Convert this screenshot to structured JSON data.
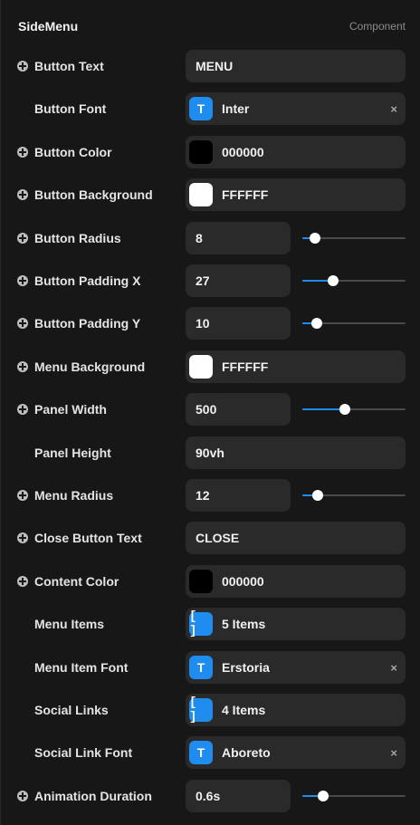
{
  "header": {
    "title": "SideMenu",
    "subtitle": "Component"
  },
  "rows": [
    {
      "label": "Button Text",
      "plus": true,
      "kind": "text",
      "value": "MENU"
    },
    {
      "label": "Button Font",
      "plus": false,
      "kind": "font",
      "value": "Inter",
      "chip": "T"
    },
    {
      "label": "Button Color",
      "plus": true,
      "kind": "color",
      "value": "000000",
      "swatch": "#000000"
    },
    {
      "label": "Button Background",
      "plus": true,
      "kind": "color",
      "value": "FFFFFF",
      "swatch": "#ffffff"
    },
    {
      "label": "Button Radius",
      "plus": true,
      "kind": "slider",
      "value": "8",
      "level": 0.12
    },
    {
      "label": "Button Padding X",
      "plus": true,
      "kind": "slider",
      "value": "27",
      "level": 0.3
    },
    {
      "label": "Button Padding Y",
      "plus": true,
      "kind": "slider",
      "value": "10",
      "level": 0.14
    },
    {
      "label": "Menu Background",
      "plus": true,
      "kind": "color",
      "value": "FFFFFF",
      "swatch": "#ffffff"
    },
    {
      "label": "Panel Width",
      "plus": true,
      "kind": "slider",
      "value": "500",
      "level": 0.41
    },
    {
      "label": "Panel Height",
      "plus": false,
      "kind": "text",
      "value": "90vh"
    },
    {
      "label": "Menu Radius",
      "plus": true,
      "kind": "slider",
      "value": "12",
      "level": 0.15
    },
    {
      "label": "Close Button Text",
      "plus": true,
      "kind": "text",
      "value": "CLOSE"
    },
    {
      "label": "Content Color",
      "plus": true,
      "kind": "color",
      "value": "000000",
      "swatch": "#000000"
    },
    {
      "label": "Menu Items",
      "plus": false,
      "kind": "array",
      "value": "5 Items",
      "chip": "[ ]"
    },
    {
      "label": "Menu Item Font",
      "plus": false,
      "kind": "font",
      "value": "Erstoria",
      "chip": "T"
    },
    {
      "label": "Social Links",
      "plus": false,
      "kind": "array",
      "value": "4 Items",
      "chip": "[ ]"
    },
    {
      "label": "Social Link Font",
      "plus": false,
      "kind": "font",
      "value": "Aboreto",
      "chip": "T"
    },
    {
      "label": "Animation Duration",
      "plus": true,
      "kind": "slider",
      "value": "0.6s",
      "level": 0.2
    }
  ],
  "clear_glyph": "×",
  "colors": {
    "accent": "#1f8cf0",
    "field": "#2a2a2a",
    "background": "#171717"
  }
}
